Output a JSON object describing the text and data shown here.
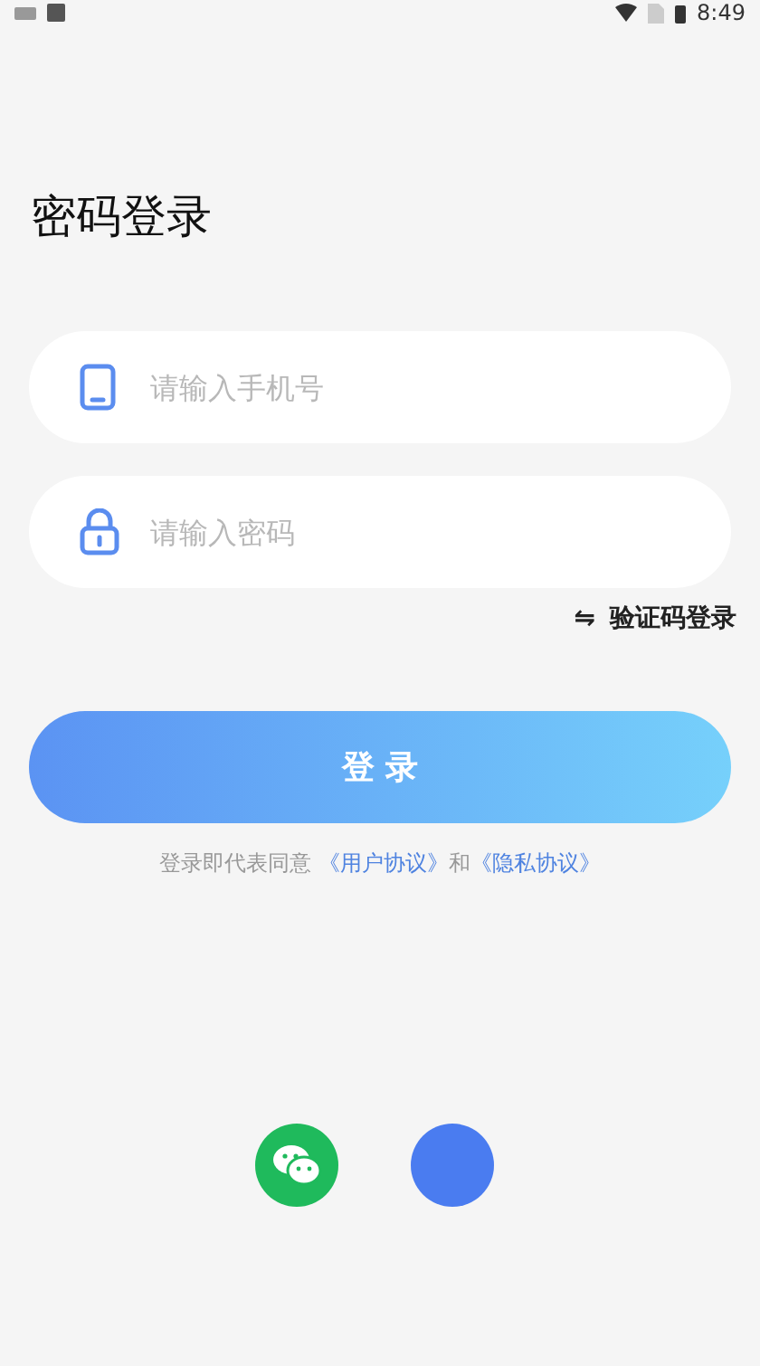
{
  "status_bar": {
    "time": "8:49"
  },
  "title": "密码登录",
  "fields": [
    {
      "kind": "phone",
      "placeholder": "请输入手机号"
    },
    {
      "kind": "lock",
      "placeholder": "请输入密码"
    }
  ],
  "switch_link": {
    "icon": "⇋",
    "label": "验证码登录"
  },
  "login_button": "登 录",
  "agreement": {
    "prefix": "登录即代表同意",
    "links": [
      "《用户协议》",
      "《隐私协议》"
    ],
    "joiner": "和"
  },
  "social": [
    {
      "kind": "wechat",
      "color": "#1fba5c"
    },
    {
      "kind": "other",
      "color": "#4a7cf0"
    }
  ]
}
